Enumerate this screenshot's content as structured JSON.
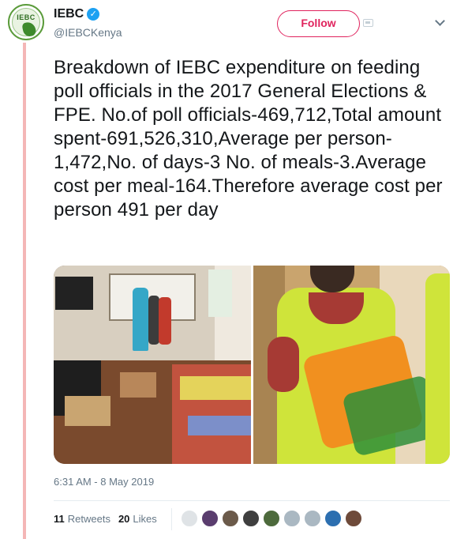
{
  "account": {
    "display_name": "IEBC",
    "handle": "@IEBCKenya",
    "verified": true,
    "avatar_text": "IEBC"
  },
  "follow_button": {
    "label": "Follow",
    "color": "#e0245e"
  },
  "tweet": {
    "text": "Breakdown of IEBC expenditure on feeding poll officials in the 2017 General Elections & FPE. No.of poll officials-469,712,Total amount spent-691,526,310,Average per person-1,472,No. of days-3 No. of meals-3.Average cost per meal-164.Therefore average cost per person 491 per day",
    "timestamp": "6:31 AM - 8 May 2019"
  },
  "stats": {
    "retweets_count": "11",
    "retweets_label": "Retweets",
    "likes_count": "20",
    "likes_label": "Likes"
  },
  "likers": [
    {
      "icon": "avatar-icon",
      "color": "#dfe3e6"
    },
    {
      "icon": "avatar-icon",
      "color": "#5a3d6e"
    },
    {
      "icon": "avatar-icon",
      "color": "#6b5a4a"
    },
    {
      "icon": "avatar-icon",
      "color": "#3f3f3f"
    },
    {
      "icon": "avatar-icon",
      "color": "#4d6a3c"
    },
    {
      "icon": "avatar-icon",
      "color": "#aab8c2"
    },
    {
      "icon": "avatar-icon",
      "color": "#aab8c2"
    },
    {
      "icon": "avatar-icon",
      "color": "#2c6fb0"
    },
    {
      "icon": "avatar-icon",
      "color": "#6e4a3a"
    }
  ],
  "colors": {
    "thread_line": "#f4b6b6",
    "verified_badge": "#1da1f2",
    "secondary_text": "#657786"
  }
}
